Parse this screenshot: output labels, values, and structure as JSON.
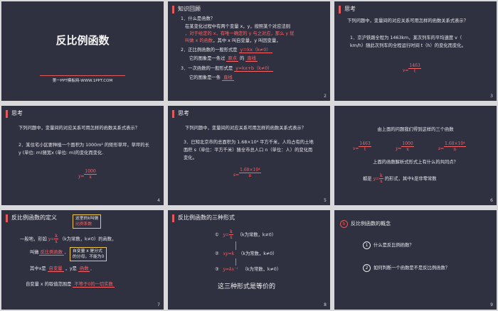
{
  "s1": {
    "title": "反比例函数",
    "site": "第一PPT模板网-WWW.1PPT.COM"
  },
  "s2": {
    "header": "知识回顾",
    "num": "2",
    "l1": "1．什么是函数？",
    "l2": "在某变化过程中有两个变量 x，y，按照某个对应法则",
    "l3": "，对于给定的 x，有唯一确定的 y 与之对应，那么 y 就",
    "l4a": "叫做 x 的函数",
    "l4b": "，其中 x 叫自变量，y 叫因变量，",
    "l5a": "2．正比例函数的一般形式是",
    "l5b": "y＝kx（k≠0）",
    "l6a": "它的图象是一条过",
    "l6b": "原点",
    "l6c": "的",
    "l6d": "直线",
    "l7a": "3．一次函数的一般形式是",
    "l7b": "y=kx+b（k≠0）",
    "l8a": "它的图象是一条",
    "l8b": "直线"
  },
  "s3": {
    "header": "思考",
    "num": "3",
    "q": "下列问题中，变量间的对应关系可用怎样的函数关系式表示？",
    "p1": "1．京沪铁路全程为 1463km，某次列车的平均速度 v（",
    "p2": "km/h）随此次列车的全程运行时间 t（h）的变化而变化。",
    "f_lhs": "v=",
    "f_num": "1463",
    "f_den": "t"
  },
  "s4": {
    "header": "思考",
    "num": "4",
    "q": "下列问题中，变量间的对应关系可用怎样的函数关系式表示？",
    "p1": "2．某住宅小区要种植一个面积为 1000m² 的矩形草坪，草坪的长",
    "p2": "y (单位: m)随宽x (单位: m)的变化而变化.",
    "f_lhs": "y=",
    "f_num": "1000",
    "f_den": "x"
  },
  "s5": {
    "header": "思考",
    "num": "5",
    "q": "下列问题中，变量间的对应关系可用怎样的函数关系式表示？",
    "p1": "3．已知北京市的总面积为 1.68×10⁴ 平方千米，人均占有的土地",
    "p2": "面积 s（单位：平方千米）随全市总人口 n（单位：人）的变化而",
    "p3": "变化。",
    "f_lhs": "s=",
    "f_num": "1.68×10⁴",
    "f_den": "n"
  },
  "s6": {
    "num": "6",
    "l1": "由上面的问题我们得到这样的三个函数",
    "f1l": "v=",
    "f1n": "1463",
    "f1d": "t",
    "f2l": "y=",
    "f2n": "1000",
    "f2d": "x",
    "f3l": "s=",
    "f3n": "1.68×10⁴",
    "f3d": "n",
    "l2": "上面的函数解析式形式上有什么的共同点？",
    "l3a": "都是",
    "l3n": "k",
    "l3d": "x",
    "l3lhs": "y=",
    "l3b": "的形式，其中k是非零常数"
  },
  "s7": {
    "header": "反比例函数的定义",
    "num": "7",
    "box1a": "这里的k叫做",
    "box1b": "比例系数",
    "l1a": "一般地，形如",
    "f_lhs": "y=",
    "f_num": "k",
    "f_den": "x",
    "l1b": "（k为常数，k≠0）的函数，",
    "l2a": "叫做",
    "l2b": "反比例函数",
    "l2c": "．",
    "box2a": "自变量 x 是分式",
    "box2b": "的分母，不能为0",
    "l3a": "其中x是",
    "l3b": "自变量",
    "l3c": "，y是",
    "l3d": "函数",
    "l3e": "．",
    "l4a": "自变量 x 的取值范围是",
    "l4b": "不等于0的一切实数"
  },
  "s8": {
    "header": "反比例函数的三种形式",
    "num": "8",
    "c1": "①",
    "c2": "②",
    "c3": "③",
    "e1l": "y=",
    "e1n": "k",
    "e1d": "x",
    "e1c": "（k为常数，k≠0）",
    "e2": "xy=k",
    "e2c": "（k为常数，k≠0）",
    "e3": "y=kx⁻¹",
    "e3c": "（k为常数，k≠0）",
    "foot": "这三种形式是等价的"
  },
  "s9": {
    "badge": "b",
    "header": "反比例函数的概念",
    "num": "9",
    "q1n": "1",
    "q1": "什么是反比例函数？",
    "q2n": "2",
    "q2": "如何判断一个函数是不是反比例函数？"
  }
}
